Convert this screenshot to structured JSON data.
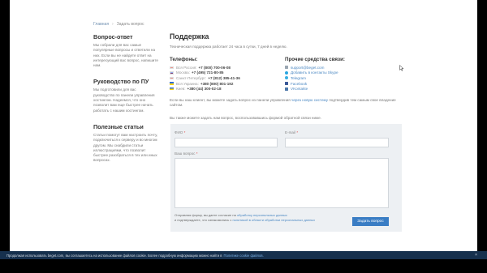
{
  "breadcrumb": {
    "home": "Главная",
    "current": "Задать вопрос"
  },
  "sidebar": {
    "sections": [
      {
        "title": "Вопрос-ответ",
        "text": "Мы собрали для вас самые популярные вопросы и ответили на них. Если вы не найдете ответ на интересующий вас вопрос, напишите нам."
      },
      {
        "title": "Руководство по ПУ",
        "text": "Мы подготовили для вас руководство по панели управления хостингом. Надеемся, что оно позволит вам еще быстрее начать работать с нашим хостингом."
      },
      {
        "title": "Полезные статьи",
        "text": "Статьи помогут вам настроить почту, подключиться к серверу и во многом другом. Мы снабдили статьи иллюстрациями, что позволит быстрее разобраться в тех или иных вопросах."
      }
    ]
  },
  "main": {
    "title": "Поддержка",
    "lead": "Техническая поддержка работает 24 часа в сутки, 7 дней в неделю.",
    "phones_title": "Телефоны:",
    "phones": [
      {
        "city": "Вся Россия:",
        "number": "+7 (800) 700-06-08"
      },
      {
        "city": "Москва:",
        "number": "+7 (495) 721-80-85"
      },
      {
        "city": "Санкт-Петербург:",
        "number": "+7 (812) 385-41-36"
      },
      {
        "city": "Вся Украина:",
        "number": "+380 (800) 801-192"
      },
      {
        "city": "Киев:",
        "number": "+380 (44) 300-02-18"
      }
    ],
    "other_title": "Прочие средства связи:",
    "other": [
      {
        "label": "support@beget.com",
        "icon": "email-icon"
      },
      {
        "label": "Добавить в контакты Skype",
        "icon": "skype-icon"
      },
      {
        "label": "Telegram",
        "icon": "telegram-icon"
      },
      {
        "label": "Facebook",
        "icon": "facebook-icon"
      },
      {
        "label": "VKontakte",
        "icon": "vk-icon"
      }
    ],
    "para1_start": "Если вы наш клиент, вы можете задать вопрос из панели управления",
    "para1_link": "через новую систему",
    "para1_end": "подтвердив тем самым свое владение сайтом.",
    "para2": "Вы также можете задать нам вопрос, воспользовавшись формой обратной связи ниже."
  },
  "form": {
    "name_label": "ФИО",
    "email_label": "E-mail",
    "question_label": "Ваш вопрос",
    "required_mark": "*",
    "agree_start": "Отправляя форму, вы даете согласие на",
    "agree_link1": "обработку персональных данных",
    "agree_mid": "и подтверждаете, что ознакомились с",
    "agree_link2": "политикой в области обработки персональных данных",
    "submit_label": "Задать вопрос"
  },
  "cookie": {
    "text": "Продолжая использовать beget.com, вы соглашаетесь на использование файлов cookie. Более подробную информацию можно найти в",
    "link": "Политике cookie файлов.",
    "close": "×"
  },
  "colors": {
    "accent": "#3a7dc4",
    "link": "#4a87c2",
    "cookie_bg": "#16304d",
    "form_bg": "#edf0f3"
  }
}
